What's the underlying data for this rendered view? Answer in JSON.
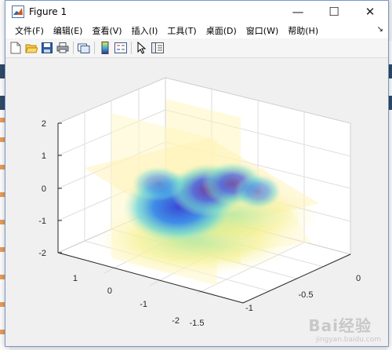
{
  "window": {
    "title": "Figure 1"
  },
  "window_controls": {
    "minimize": "—",
    "maximize": "☐",
    "close": "✕"
  },
  "menu": {
    "items": [
      {
        "label": "文件(F)"
      },
      {
        "label": "编辑(E)"
      },
      {
        "label": "查看(V)"
      },
      {
        "label": "插入(I)"
      },
      {
        "label": "工具(T)"
      },
      {
        "label": "桌面(D)"
      },
      {
        "label": "窗口(W)"
      },
      {
        "label": "帮助(H)"
      }
    ],
    "overflow_arrow": "↘"
  },
  "toolbar": {
    "buttons": [
      "new-figure-icon",
      "open-file-icon",
      "save-icon",
      "print-icon",
      "link-plot-icon",
      "colorbar-icon",
      "legend-icon",
      "pointer-icon",
      "property-inspector-icon"
    ]
  },
  "axes": {
    "z_ticks": [
      "2",
      "1",
      "0",
      "-1",
      "-2"
    ],
    "y_ticks": [
      "1",
      "0",
      "-1",
      "-2"
    ],
    "x_ticks": [
      "0",
      "-0.5",
      "-1",
      "-1.5"
    ]
  },
  "watermark": {
    "text": "Bai经验",
    "sub": "jingyan.baidu.com"
  }
}
